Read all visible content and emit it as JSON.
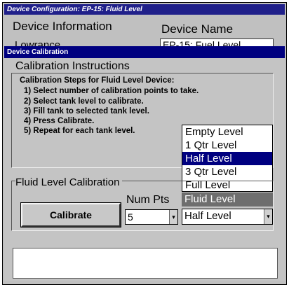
{
  "background_window": {
    "title": "Device Configuration: EP-15: Fluid Level",
    "device_info_label": "Device Information",
    "device_info_value": "Lowrance",
    "device_name_label": "Device Name",
    "device_name_value": "EP-15: Fuel Level"
  },
  "dialog": {
    "title": "Device Calibration",
    "instructions_title": "Calibration Instructions",
    "instructions": [
      "Calibration Steps for Fluid Level Device:",
      "1) Select number of calibration points to take.",
      "2) Select tank level to calibrate.",
      "3) Fill tank to selected tank level.",
      "4) Press Calibrate.",
      "5) Repeat for each tank level."
    ],
    "levels": [
      "Empty Level",
      "1 Qtr Level",
      "Half Level",
      "3 Qtr Level",
      "Full Level"
    ],
    "selected_level_index": 2,
    "fluid_level_caption": "Fluid Level",
    "fluid_calibration_title": "Fluid Level Calibration",
    "calibrate_button": "Calibrate",
    "num_pts_label": "Num Pts",
    "num_pts_value": "5",
    "level_select_value": "Half Level"
  }
}
